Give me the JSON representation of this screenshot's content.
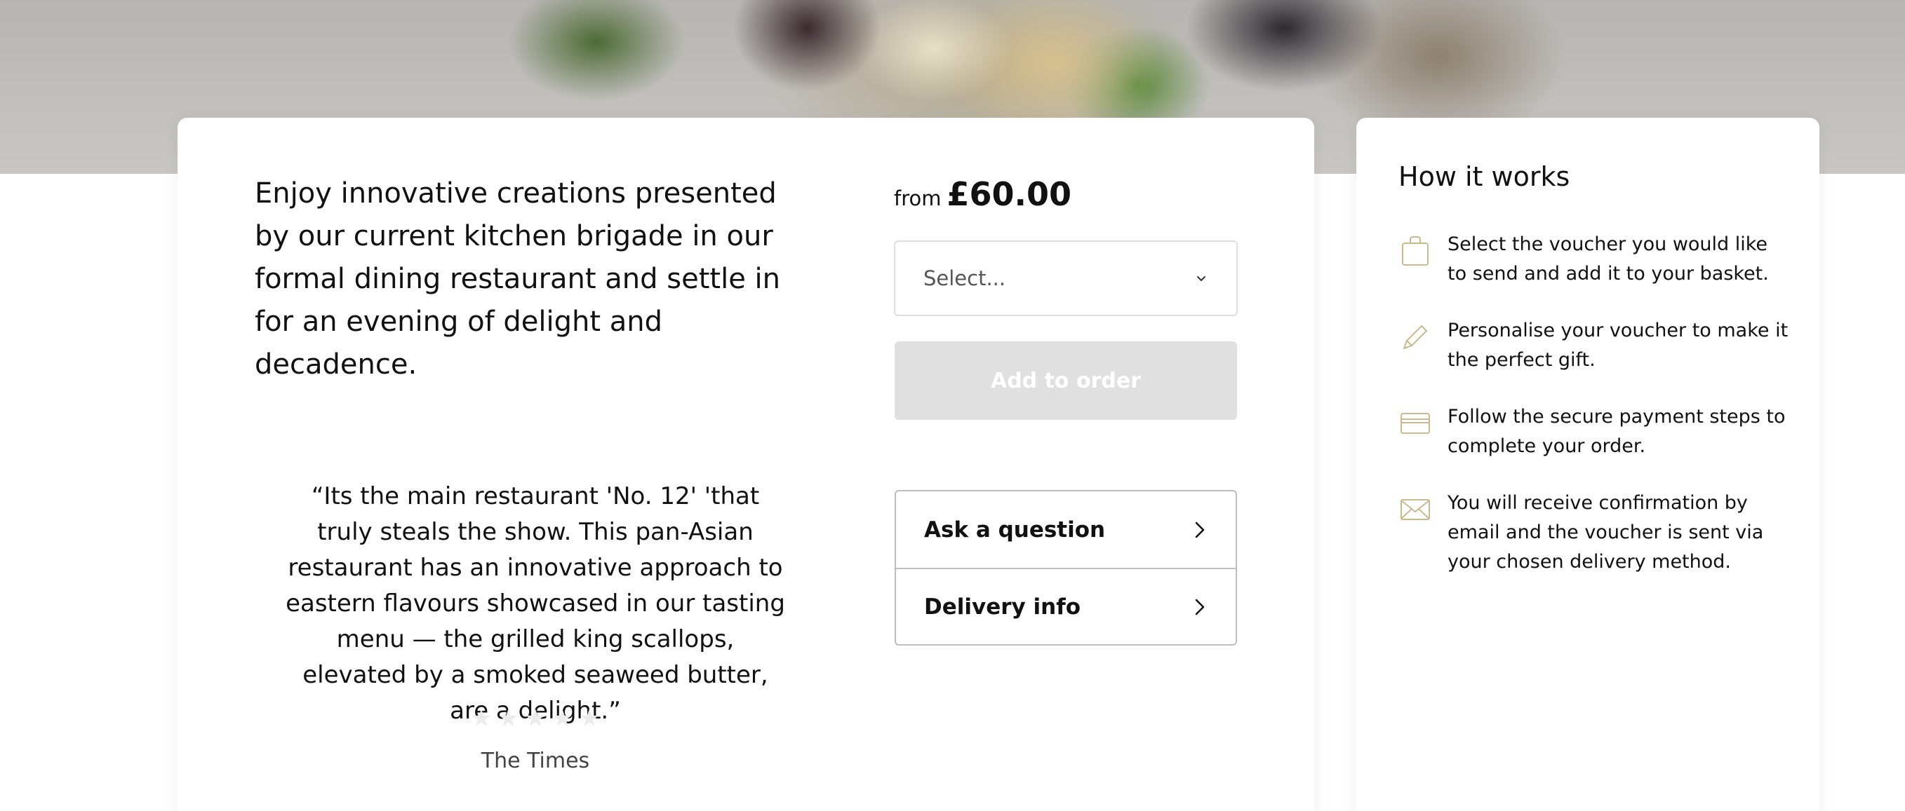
{
  "main": {
    "intro_text": "Enjoy innovative creations presented by our current kitchen brigade in our formal dining restaurant and settle in for an evening of delight and decadence.",
    "price": {
      "prefix": "from",
      "value": "£60.00"
    },
    "select": {
      "placeholder": "Select..."
    },
    "add_to_order_label": "Add to order",
    "accordion": {
      "ask_label": "Ask a question",
      "delivery_label": "Delivery info"
    },
    "review": {
      "quote": "“Its the main restaurant 'No. 12' 'that truly steals the show. This pan-Asian restaurant has an innovative approach to eastern flavours showcased in our tasting menu — the grilled king scallops, elevated by a smoked seaweed butter, are a delight.”",
      "rating": 0,
      "rating_max": 5,
      "source": "The Times"
    }
  },
  "how_it_works": {
    "title": "How it works",
    "steps": [
      {
        "icon": "shopping-bag-icon",
        "text": "Select the voucher you would like to send and add it to your basket."
      },
      {
        "icon": "pencil-icon",
        "text": "Personalise your voucher to make it the perfect gift."
      },
      {
        "icon": "credit-card-icon",
        "text": "Follow the secure payment steps to complete your order."
      },
      {
        "icon": "envelope-icon",
        "text": "You will receive confirmation by email and the voucher is sent via your chosen delivery method."
      }
    ]
  },
  "colors": {
    "icon_gold": "#c9b98d",
    "button_disabled": "#e0e0e0",
    "star_empty": "#ececec"
  }
}
